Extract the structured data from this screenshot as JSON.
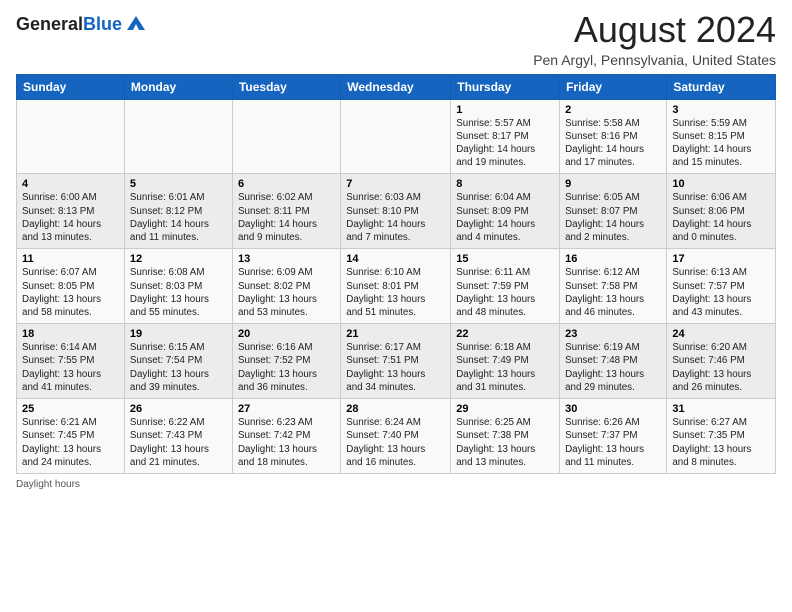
{
  "logo": {
    "line1": "General",
    "line2": "Blue"
  },
  "title": "August 2024",
  "subtitle": "Pen Argyl, Pennsylvania, United States",
  "days_of_week": [
    "Sunday",
    "Monday",
    "Tuesday",
    "Wednesday",
    "Thursday",
    "Friday",
    "Saturday"
  ],
  "footer": "Daylight hours",
  "weeks": [
    [
      {
        "day": "",
        "info": ""
      },
      {
        "day": "",
        "info": ""
      },
      {
        "day": "",
        "info": ""
      },
      {
        "day": "",
        "info": ""
      },
      {
        "day": "1",
        "info": "Sunrise: 5:57 AM\nSunset: 8:17 PM\nDaylight: 14 hours\nand 19 minutes."
      },
      {
        "day": "2",
        "info": "Sunrise: 5:58 AM\nSunset: 8:16 PM\nDaylight: 14 hours\nand 17 minutes."
      },
      {
        "day": "3",
        "info": "Sunrise: 5:59 AM\nSunset: 8:15 PM\nDaylight: 14 hours\nand 15 minutes."
      }
    ],
    [
      {
        "day": "4",
        "info": "Sunrise: 6:00 AM\nSunset: 8:13 PM\nDaylight: 14 hours\nand 13 minutes."
      },
      {
        "day": "5",
        "info": "Sunrise: 6:01 AM\nSunset: 8:12 PM\nDaylight: 14 hours\nand 11 minutes."
      },
      {
        "day": "6",
        "info": "Sunrise: 6:02 AM\nSunset: 8:11 PM\nDaylight: 14 hours\nand 9 minutes."
      },
      {
        "day": "7",
        "info": "Sunrise: 6:03 AM\nSunset: 8:10 PM\nDaylight: 14 hours\nand 7 minutes."
      },
      {
        "day": "8",
        "info": "Sunrise: 6:04 AM\nSunset: 8:09 PM\nDaylight: 14 hours\nand 4 minutes."
      },
      {
        "day": "9",
        "info": "Sunrise: 6:05 AM\nSunset: 8:07 PM\nDaylight: 14 hours\nand 2 minutes."
      },
      {
        "day": "10",
        "info": "Sunrise: 6:06 AM\nSunset: 8:06 PM\nDaylight: 14 hours\nand 0 minutes."
      }
    ],
    [
      {
        "day": "11",
        "info": "Sunrise: 6:07 AM\nSunset: 8:05 PM\nDaylight: 13 hours\nand 58 minutes."
      },
      {
        "day": "12",
        "info": "Sunrise: 6:08 AM\nSunset: 8:03 PM\nDaylight: 13 hours\nand 55 minutes."
      },
      {
        "day": "13",
        "info": "Sunrise: 6:09 AM\nSunset: 8:02 PM\nDaylight: 13 hours\nand 53 minutes."
      },
      {
        "day": "14",
        "info": "Sunrise: 6:10 AM\nSunset: 8:01 PM\nDaylight: 13 hours\nand 51 minutes."
      },
      {
        "day": "15",
        "info": "Sunrise: 6:11 AM\nSunset: 7:59 PM\nDaylight: 13 hours\nand 48 minutes."
      },
      {
        "day": "16",
        "info": "Sunrise: 6:12 AM\nSunset: 7:58 PM\nDaylight: 13 hours\nand 46 minutes."
      },
      {
        "day": "17",
        "info": "Sunrise: 6:13 AM\nSunset: 7:57 PM\nDaylight: 13 hours\nand 43 minutes."
      }
    ],
    [
      {
        "day": "18",
        "info": "Sunrise: 6:14 AM\nSunset: 7:55 PM\nDaylight: 13 hours\nand 41 minutes."
      },
      {
        "day": "19",
        "info": "Sunrise: 6:15 AM\nSunset: 7:54 PM\nDaylight: 13 hours\nand 39 minutes."
      },
      {
        "day": "20",
        "info": "Sunrise: 6:16 AM\nSunset: 7:52 PM\nDaylight: 13 hours\nand 36 minutes."
      },
      {
        "day": "21",
        "info": "Sunrise: 6:17 AM\nSunset: 7:51 PM\nDaylight: 13 hours\nand 34 minutes."
      },
      {
        "day": "22",
        "info": "Sunrise: 6:18 AM\nSunset: 7:49 PM\nDaylight: 13 hours\nand 31 minutes."
      },
      {
        "day": "23",
        "info": "Sunrise: 6:19 AM\nSunset: 7:48 PM\nDaylight: 13 hours\nand 29 minutes."
      },
      {
        "day": "24",
        "info": "Sunrise: 6:20 AM\nSunset: 7:46 PM\nDaylight: 13 hours\nand 26 minutes."
      }
    ],
    [
      {
        "day": "25",
        "info": "Sunrise: 6:21 AM\nSunset: 7:45 PM\nDaylight: 13 hours\nand 24 minutes."
      },
      {
        "day": "26",
        "info": "Sunrise: 6:22 AM\nSunset: 7:43 PM\nDaylight: 13 hours\nand 21 minutes."
      },
      {
        "day": "27",
        "info": "Sunrise: 6:23 AM\nSunset: 7:42 PM\nDaylight: 13 hours\nand 18 minutes."
      },
      {
        "day": "28",
        "info": "Sunrise: 6:24 AM\nSunset: 7:40 PM\nDaylight: 13 hours\nand 16 minutes."
      },
      {
        "day": "29",
        "info": "Sunrise: 6:25 AM\nSunset: 7:38 PM\nDaylight: 13 hours\nand 13 minutes."
      },
      {
        "day": "30",
        "info": "Sunrise: 6:26 AM\nSunset: 7:37 PM\nDaylight: 13 hours\nand 11 minutes."
      },
      {
        "day": "31",
        "info": "Sunrise: 6:27 AM\nSunset: 7:35 PM\nDaylight: 13 hours\nand 8 minutes."
      }
    ]
  ]
}
